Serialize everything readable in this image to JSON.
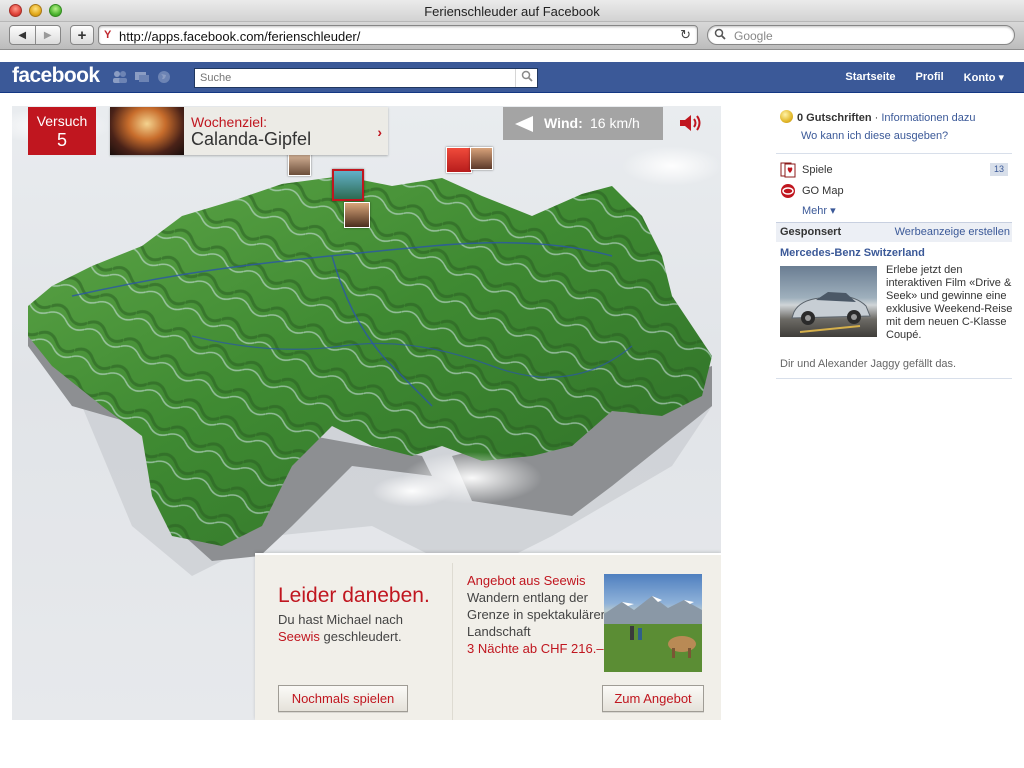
{
  "browser": {
    "window_title": "Ferienschleuder auf Facebook",
    "url": "http://apps.facebook.com/ferienschleuder/",
    "search_placeholder": "Google",
    "back_icon": "◀",
    "forward_icon": "▶",
    "add_icon": "+",
    "reload_icon": "↻"
  },
  "facebook": {
    "logo": "facebook",
    "search_placeholder": "Suche",
    "nav": [
      "Startseite",
      "Profil",
      "Konto ▾"
    ]
  },
  "game": {
    "versuch_label": "Versuch",
    "versuch_value": "5",
    "wochenziel_label": "Wochenziel:",
    "wochenziel_value": "Calanda-Gipfel",
    "chevron": "›",
    "wind_label": "Wind:",
    "wind_value": "16 km/h",
    "result": {
      "title": "Leider daneben.",
      "line1": "Du hast Michael nach",
      "place": "Seewis",
      "line2_rest": " geschleudert.",
      "again_button": "Nochmals spielen"
    },
    "offer": {
      "title": "Angebot aus Seewis",
      "text": "Wandern entlang der Grenze in spektakulärer Landschaft",
      "price": "3 Nächte ab CHF 216.–",
      "button": "Zum Angebot"
    }
  },
  "sidebar": {
    "credits_count": "0 Gutschriften",
    "credits_sep": " · ",
    "credits_info": "Informationen dazu",
    "credits_where": "Wo kann ich diese ausgeben?",
    "apps": [
      {
        "name": "Spiele",
        "count": "13"
      },
      {
        "name": "GO Map",
        "count": ""
      }
    ],
    "more": "Mehr ▾",
    "sponsored_label": "Gesponsert",
    "create_ad": "Werbeanzeige erstellen",
    "ad": {
      "title": "Mercedes-Benz Switzerland",
      "body": "Erlebe jetzt den interaktiven Film «Drive & Seek» und gewinne eine exklusive Weekend-Reise mit dem neuen C-Klasse Coupé.",
      "likes": "Dir und Alexander Jaggy gefällt das."
    }
  },
  "colors": {
    "fb_blue": "#3b5998",
    "accent_red": "#c0161f",
    "terrain_green": "#3f8a32"
  },
  "icons": {
    "speaker": "speaker-icon",
    "wind_arrow": "arrow-left-icon",
    "search": "magnifier-icon"
  }
}
